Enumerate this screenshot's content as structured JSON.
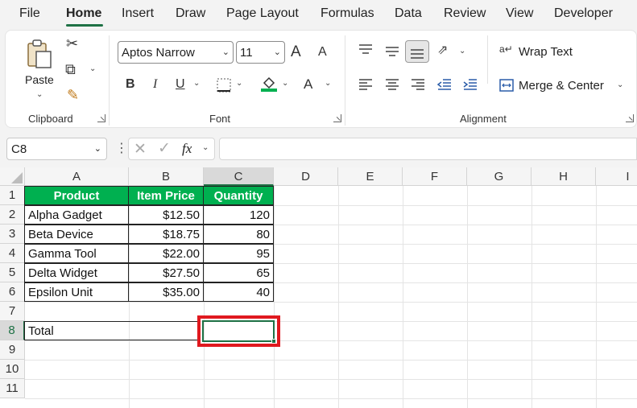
{
  "menu": {
    "tabs": [
      "File",
      "Home",
      "Insert",
      "Draw",
      "Page Layout",
      "Formulas",
      "Data",
      "Review",
      "View",
      "Developer"
    ],
    "active": "Home"
  },
  "ribbon": {
    "clipboard": {
      "paste_label": "Paste",
      "group_label": "Clipboard"
    },
    "font": {
      "font_name": "Aptos Narrow",
      "font_size": "11",
      "grow_label": "A",
      "shrink_label": "A",
      "bold": "B",
      "italic": "I",
      "underline": "U",
      "font_color_letter": "A",
      "group_label": "Font"
    },
    "alignment": {
      "wrap_text": "Wrap Text",
      "merge_center": "Merge & Center",
      "group_label": "Alignment"
    }
  },
  "formula_bar": {
    "name_box": "C8",
    "fx_label": "fx",
    "formula": ""
  },
  "sheet": {
    "columns": [
      "A",
      "B",
      "C",
      "D",
      "E",
      "F",
      "G",
      "H",
      "I"
    ],
    "selected_column": "C",
    "rows": [
      "1",
      "2",
      "3",
      "4",
      "5",
      "6",
      "7",
      "8",
      "9",
      "10",
      "11"
    ],
    "selected_row": "8",
    "header": [
      "Product",
      "Item Price",
      "Quantity"
    ],
    "data": [
      [
        "Alpha Gadget",
        "$12.50",
        "120"
      ],
      [
        "Beta Device",
        "$18.75",
        "80"
      ],
      [
        "Gamma Tool",
        "$22.00",
        "95"
      ],
      [
        "Delta Widget",
        "$27.50",
        "65"
      ],
      [
        "Epsilon Unit",
        "$35.00",
        "40"
      ]
    ],
    "total_label": "Total",
    "active_cell": "C8"
  },
  "colors": {
    "accent": "#1e7145",
    "header_fill": "#00b050",
    "highlight": "#e0191f"
  }
}
